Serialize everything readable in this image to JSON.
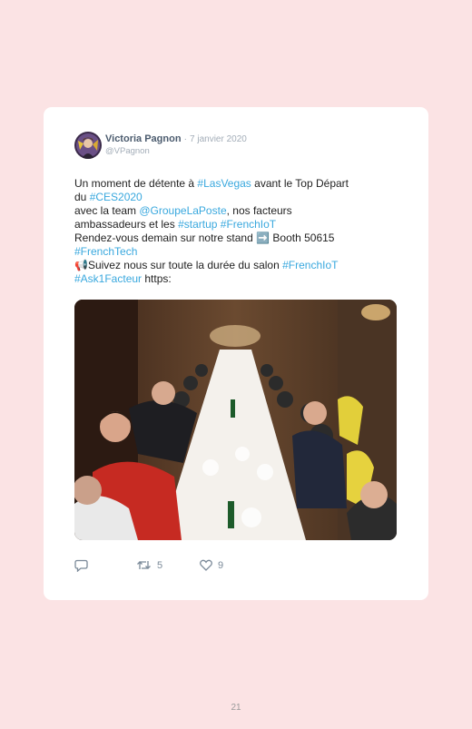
{
  "tweet": {
    "author_name": "Victoria Pagnon",
    "separator": "·",
    "date": "7 janvier 2020",
    "handle": "@VPagnon",
    "lines": [
      [
        {
          "t": "Un moment de détente à ",
          "k": "text"
        },
        {
          "t": "#LasVegas",
          "k": "tag"
        },
        {
          "t": " avant le Top Départ",
          "k": "text"
        }
      ],
      [
        {
          "t": "du ",
          "k": "text"
        },
        {
          "t": "#CES2020",
          "k": "tag"
        }
      ],
      [
        {
          "t": "avec la team ",
          "k": "text"
        },
        {
          "t": "@GroupeLaPoste",
          "k": "tag"
        },
        {
          "t": ", nos facteurs",
          "k": "text"
        }
      ],
      [
        {
          "t": "ambassadeurs et les ",
          "k": "text"
        },
        {
          "t": "#startup",
          "k": "tag"
        },
        {
          "t": " ",
          "k": "text"
        },
        {
          "t": "#FrenchIoT",
          "k": "tag"
        }
      ],
      [
        {
          "t": "Rendez-vous demain sur notre stand ",
          "k": "text"
        },
        {
          "t": "➡️",
          "k": "emoji"
        },
        {
          "t": " Booth 50615",
          "k": "text"
        }
      ],
      [
        {
          "t": "#FrenchTech",
          "k": "tag"
        }
      ],
      [
        {
          "t": "📢",
          "k": "emoji"
        },
        {
          "t": "Suivez nous sur toute la durée du salon ",
          "k": "text"
        },
        {
          "t": "#FrenchIoT",
          "k": "tag"
        }
      ],
      [
        {
          "t": "#Ask1Facteur",
          "k": "tag"
        },
        {
          "t": " https:",
          "k": "text"
        }
      ]
    ],
    "retweets": "5",
    "likes": "9"
  },
  "page_number": "21",
  "colors": {
    "page_background": "#fbe3e4",
    "card": "#ffffff",
    "hashtag": "#39a8de",
    "author": "#4b5b6e",
    "muted": "#a3adb8"
  },
  "icons": [
    "reply-icon",
    "retweet-icon",
    "like-icon"
  ]
}
